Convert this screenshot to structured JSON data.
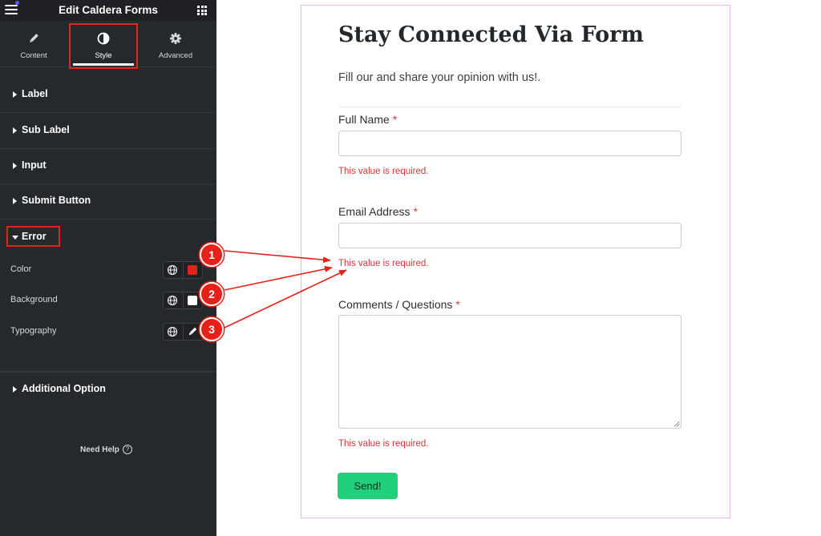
{
  "panel": {
    "title": "Edit Caldera Forms",
    "tabs": [
      {
        "label": "Content"
      },
      {
        "label": "Style"
      },
      {
        "label": "Advanced"
      }
    ],
    "sections": [
      {
        "label": "Label"
      },
      {
        "label": "Sub Label"
      },
      {
        "label": "Input"
      },
      {
        "label": "Submit Button"
      },
      {
        "label": "Error"
      },
      {
        "label": "Additional Option"
      }
    ],
    "error_controls": {
      "color_label": "Color",
      "color_value": "#e0241c",
      "background_label": "Background",
      "background_value": "#ffffff",
      "typography_label": "Typography"
    },
    "need_help": "Need Help",
    "help_icon_glyph": "?"
  },
  "form": {
    "title": "Stay Connected Via Form",
    "subtitle": "Fill our and share your opinion with us!.",
    "fields": [
      {
        "label": "Full Name",
        "required_mark": "*",
        "error": "This value is required."
      },
      {
        "label": "Email Address",
        "required_mark": "*",
        "error": "This value is required."
      },
      {
        "label": "Comments / Questions",
        "required_mark": "*",
        "error": "This value is required."
      }
    ],
    "submit_label": "Send!"
  },
  "annotations": {
    "badges": [
      "1",
      "2",
      "3"
    ],
    "color": "#e8201a"
  },
  "colors": {
    "panel_bg": "#26292c",
    "accent_red": "#e0241c",
    "send_button": "#22d07b",
    "error_text": "#d63638",
    "frame_border": "#e9b7ea"
  }
}
